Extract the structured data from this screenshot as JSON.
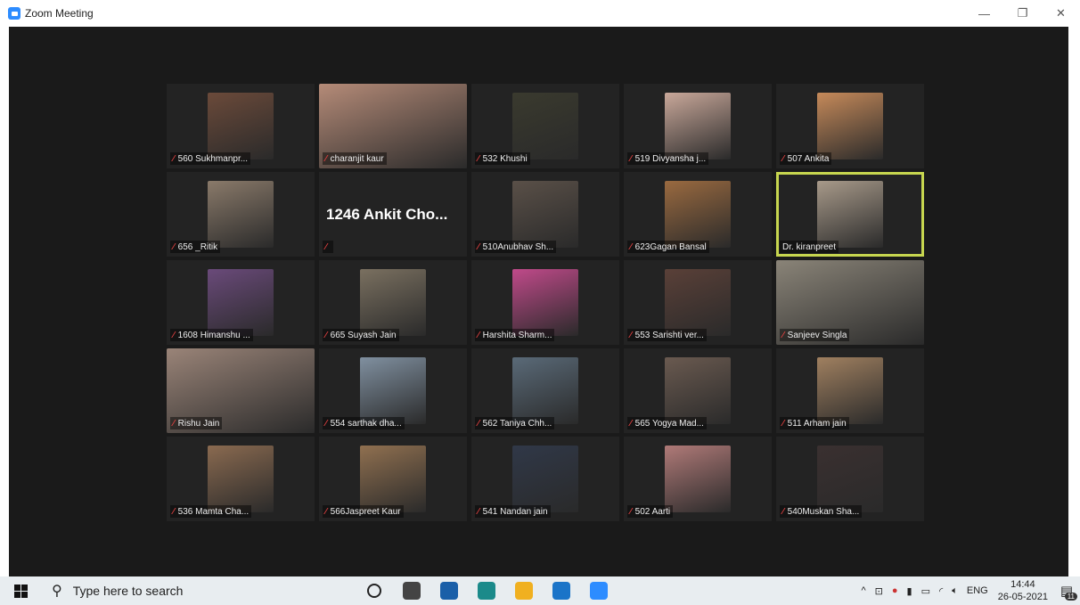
{
  "window": {
    "title": "Zoom Meeting",
    "minimize": "—",
    "restore": "❐",
    "close": "✕"
  },
  "participants": [
    {
      "name": "560 Sukhmanpr...",
      "muted": true,
      "color": "#6b4a3a"
    },
    {
      "name": "charanjit kaur",
      "muted": true,
      "color": "#b58b78"
    },
    {
      "name": "532 Khushi",
      "muted": true,
      "color": "#3a3a2e"
    },
    {
      "name": "519 Divyansha j...",
      "muted": true,
      "color": "#c9a89a"
    },
    {
      "name": "507 Ankita",
      "muted": true,
      "color": "#c68a5a"
    },
    {
      "name": "656 _Ritik",
      "muted": true,
      "color": "#8a7a6a"
    },
    {
      "name": "",
      "big": "1246 Ankit Cho...",
      "muted": true,
      "color": ""
    },
    {
      "name": "510Anubhav Sh...",
      "muted": true,
      "color": "#5a5048"
    },
    {
      "name": "623Gagan Bansal",
      "muted": true,
      "color": "#9a6a40"
    },
    {
      "name": "Dr. kiranpreet",
      "muted": false,
      "color": "#a89a8a",
      "active": true
    },
    {
      "name": "1608 Himanshu ...",
      "muted": true,
      "color": "#6a4a7a"
    },
    {
      "name": "665 Suyash Jain",
      "muted": true,
      "color": "#7a7060"
    },
    {
      "name": "Harshita Sharm...",
      "muted": true,
      "color": "#c04a8a"
    },
    {
      "name": "553 Sarishti ver...",
      "muted": true,
      "color": "#5a4038"
    },
    {
      "name": "Sanjeev Singla",
      "muted": true,
      "color": "#8a8478"
    },
    {
      "name": "Rishu Jain",
      "muted": true,
      "color": "#9a8478"
    },
    {
      "name": "554 sarthak dha...",
      "muted": true,
      "color": "#8090a0"
    },
    {
      "name": "562 Taniya Chh...",
      "muted": true,
      "color": "#5a6a78"
    },
    {
      "name": "565 Yogya Mad...",
      "muted": true,
      "color": "#6a5a50"
    },
    {
      "name": "511 Arham jain",
      "muted": true,
      "color": "#a08060"
    },
    {
      "name": "536 Mamta Cha...",
      "muted": true,
      "color": "#8a6a50"
    },
    {
      "name": "566Jaspreet Kaur",
      "muted": true,
      "color": "#907050"
    },
    {
      "name": "541 Nandan jain",
      "muted": true,
      "color": "#303848"
    },
    {
      "name": "502 Aarti",
      "muted": true,
      "color": "#b07a78"
    },
    {
      "name": "540Muskan Sha...",
      "muted": true,
      "color": "#3a3030"
    }
  ],
  "taskbar": {
    "search_placeholder": "Type here to search",
    "apps": [
      {
        "icon": "cortana-icon",
        "color": "#222"
      },
      {
        "icon": "task-view-icon",
        "color": "#444"
      },
      {
        "icon": "mail-icon",
        "color": "#1a5fa8"
      },
      {
        "icon": "edge-icon",
        "color": "#1b8a8a"
      },
      {
        "icon": "file-explorer-icon",
        "color": "#f0b020"
      },
      {
        "icon": "dell-icon",
        "color": "#1a74c8"
      },
      {
        "icon": "zoom-icon",
        "color": "#2d8cff"
      }
    ],
    "language": "ENG",
    "time": "14:44",
    "date": "26-05-2021",
    "notification_count": "11"
  }
}
